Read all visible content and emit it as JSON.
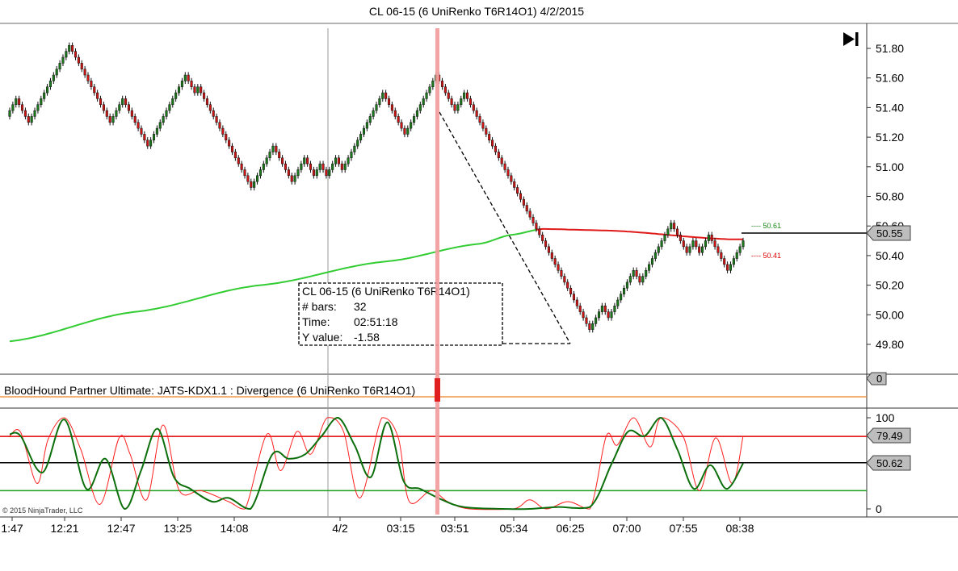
{
  "window": {
    "title": "CL 06-15 (6 UniRenko T6R14O1)  4/2/2015"
  },
  "copyright": "© 2015 NinjaTrader, LLC",
  "icons": {
    "go_to_end": "skip-to-end-icon"
  },
  "colors": {
    "up_bar": "#1a7a1a",
    "down_bar": "#d01414",
    "sma_green": "#33cc33",
    "sma_red": "#e01818",
    "cursor_line": "#f29a9a",
    "osc_fast": "#ff2020",
    "osc_slow": "#0c6f0c",
    "level_red": "#e00000",
    "level_green": "#1aa01a",
    "level_black": "#000000",
    "orange_line": "#f08020"
  },
  "price_panel": {
    "y_ticks": [
      "51.80",
      "51.60",
      "51.40",
      "51.20",
      "51.00",
      "50.80",
      "50.60",
      "50.40",
      "50.20",
      "50.00",
      "49.80"
    ],
    "current_price": "50.55",
    "marker_upper": "---- 50.61",
    "marker_lower": "---- 50.41"
  },
  "measure_tooltip": {
    "title": "CL 06-15 (6 UniRenko T6R14O1)",
    "bars_label": "# bars:",
    "bars_value": "32",
    "time_label": "Time:",
    "time_value": "02:51:18",
    "y_label": "Y value:",
    "y_value": "-1.58"
  },
  "divergence_panel": {
    "label": "BloodHound Partner Ultimate: JATS-KDX1.1 : Divergence (6 UniRenko T6R14O1)",
    "value": "0"
  },
  "oscillator_panel": {
    "y_ticks": [
      "100",
      "0"
    ],
    "upper_level": "79.49",
    "middle_level": "50.62"
  },
  "x_axis": {
    "ticks": [
      "1:47",
      "12:21",
      "12:47",
      "13:25",
      "14:08",
      "4/2",
      "03:15",
      "03:51",
      "05:34",
      "06:25",
      "07:00",
      "07:55",
      "08:38"
    ]
  },
  "chart_data": [
    {
      "type": "candlestick",
      "title": "CL 06-15 (6 UniRenko T6R14O1)  4/2/2015",
      "ylim": [
        49.74,
        51.9
      ],
      "bar_step": 0.04,
      "note_label_y_axis": "price",
      "closes": [
        51.38,
        51.42,
        51.46,
        51.42,
        51.38,
        51.34,
        51.3,
        51.34,
        51.38,
        51.42,
        51.46,
        51.5,
        51.54,
        51.58,
        51.62,
        51.66,
        51.7,
        51.74,
        51.78,
        51.82,
        51.78,
        51.74,
        51.7,
        51.66,
        51.62,
        51.58,
        51.54,
        51.5,
        51.46,
        51.42,
        51.38,
        51.34,
        51.3,
        51.34,
        51.38,
        51.42,
        51.46,
        51.42,
        51.38,
        51.34,
        51.3,
        51.26,
        51.22,
        51.18,
        51.14,
        51.18,
        51.22,
        51.26,
        51.3,
        51.34,
        51.38,
        51.42,
        51.46,
        51.5,
        51.54,
        51.58,
        51.62,
        51.58,
        51.54,
        51.5,
        51.54,
        51.5,
        51.46,
        51.42,
        51.38,
        51.34,
        51.3,
        51.26,
        51.22,
        51.18,
        51.14,
        51.1,
        51.06,
        51.02,
        50.98,
        50.94,
        50.9,
        50.86,
        50.9,
        50.94,
        50.98,
        51.02,
        51.06,
        51.1,
        51.14,
        51.1,
        51.06,
        51.02,
        50.98,
        50.94,
        50.9,
        50.94,
        50.98,
        51.02,
        51.06,
        51.02,
        50.98,
        50.94,
        50.98,
        51.02,
        50.98,
        50.94,
        50.98,
        51.02,
        51.06,
        51.02,
        50.98,
        51.02,
        51.06,
        51.1,
        51.14,
        51.18,
        51.22,
        51.26,
        51.3,
        51.34,
        51.38,
        51.42,
        51.46,
        51.5,
        51.46,
        51.42,
        51.38,
        51.34,
        51.3,
        51.26,
        51.22,
        51.26,
        51.3,
        51.34,
        51.38,
        51.42,
        51.46,
        51.5,
        51.54,
        51.58,
        51.62,
        51.58,
        51.54,
        51.5,
        51.46,
        51.42,
        51.38,
        51.42,
        51.46,
        51.5,
        51.46,
        51.42,
        51.38,
        51.34,
        51.3,
        51.26,
        51.22,
        51.18,
        51.14,
        51.1,
        51.06,
        51.02,
        50.98,
        50.94,
        50.9,
        50.86,
        50.82,
        50.78,
        50.74,
        50.7,
        50.66,
        50.62,
        50.58,
        50.54,
        50.5,
        50.46,
        50.42,
        50.38,
        50.34,
        50.3,
        50.26,
        50.22,
        50.18,
        50.14,
        50.1,
        50.06,
        50.02,
        49.98,
        49.94,
        49.9,
        49.94,
        49.98,
        50.02,
        50.06,
        50.02,
        49.98,
        50.02,
        50.06,
        50.1,
        50.14,
        50.18,
        50.22,
        50.26,
        50.3,
        50.26,
        50.22,
        50.26,
        50.3,
        50.34,
        50.38,
        50.42,
        50.46,
        50.5,
        50.54,
        50.58,
        50.62,
        50.58,
        50.54,
        50.5,
        50.46,
        50.42,
        50.46,
        50.5,
        50.46,
        50.42,
        50.46,
        50.5,
        50.54,
        50.5,
        50.46,
        50.42,
        50.38,
        50.34,
        50.3,
        50.34,
        50.38,
        50.42,
        50.46,
        50.5
      ],
      "sma": {
        "anchors_index": [
          0,
          40,
          80,
          120,
          150,
          160,
          170,
          190,
          230
        ],
        "anchors_value": [
          49.82,
          50.02,
          50.2,
          50.36,
          50.48,
          50.54,
          50.58,
          50.57,
          50.51
        ],
        "turn_red_after_index": 168
      }
    },
    {
      "type": "line",
      "title": "BloodHound Partner Ultimate: JATS-KDX1.1 : Divergence (6 UniRenko T6R14O1)",
      "ylim": [
        -1,
        1
      ],
      "series": [
        {
          "name": "Divergence",
          "values": [
            0,
            0
          ]
        }
      ]
    },
    {
      "type": "line",
      "ylim": [
        0,
        100
      ],
      "levels": [
        79.49,
        50.62,
        20
      ],
      "fast_anchors": [
        [
          0,
          80
        ],
        [
          4,
          84
        ],
        [
          10,
          28
        ],
        [
          14,
          76
        ],
        [
          20,
          100
        ],
        [
          26,
          65
        ],
        [
          33,
          5
        ],
        [
          40,
          78
        ],
        [
          44,
          60
        ],
        [
          50,
          10
        ],
        [
          56,
          92
        ],
        [
          62,
          20
        ],
        [
          70,
          20
        ],
        [
          80,
          8
        ],
        [
          86,
          0
        ],
        [
          94,
          82
        ],
        [
          99,
          42
        ],
        [
          105,
          85
        ],
        [
          110,
          60
        ],
        [
          116,
          100
        ],
        [
          122,
          85
        ],
        [
          128,
          12
        ],
        [
          136,
          100
        ],
        [
          142,
          78
        ],
        [
          146,
          8
        ],
        [
          154,
          20
        ],
        [
          160,
          8
        ],
        [
          168,
          0
        ],
        [
          184,
          0
        ],
        [
          190,
          10
        ],
        [
          196,
          0
        ],
        [
          204,
          8
        ],
        [
          212,
          0
        ],
        [
          218,
          80
        ],
        [
          222,
          70
        ],
        [
          228,
          100
        ],
        [
          234,
          68
        ],
        [
          238,
          100
        ],
        [
          246,
          80
        ],
        [
          252,
          20
        ],
        [
          258,
          78
        ],
        [
          264,
          28
        ],
        [
          268,
          80
        ]
      ],
      "slow_anchors": [
        [
          0,
          82
        ],
        [
          4,
          80
        ],
        [
          12,
          40
        ],
        [
          20,
          98
        ],
        [
          28,
          22
        ],
        [
          35,
          55
        ],
        [
          42,
          0
        ],
        [
          48,
          42
        ],
        [
          54,
          88
        ],
        [
          60,
          35
        ],
        [
          66,
          22
        ],
        [
          74,
          8
        ],
        [
          80,
          12
        ],
        [
          88,
          0
        ],
        [
          96,
          60
        ],
        [
          102,
          55
        ],
        [
          108,
          60
        ],
        [
          114,
          80
        ],
        [
          120,
          100
        ],
        [
          126,
          70
        ],
        [
          132,
          35
        ],
        [
          138,
          95
        ],
        [
          144,
          30
        ],
        [
          150,
          22
        ],
        [
          158,
          10
        ],
        [
          166,
          2
        ],
        [
          180,
          0
        ],
        [
          190,
          0
        ],
        [
          200,
          2
        ],
        [
          212,
          2
        ],
        [
          220,
          50
        ],
        [
          226,
          85
        ],
        [
          232,
          80
        ],
        [
          238,
          100
        ],
        [
          244,
          65
        ],
        [
          250,
          22
        ],
        [
          256,
          48
        ],
        [
          262,
          22
        ],
        [
          268,
          50
        ]
      ]
    }
  ]
}
